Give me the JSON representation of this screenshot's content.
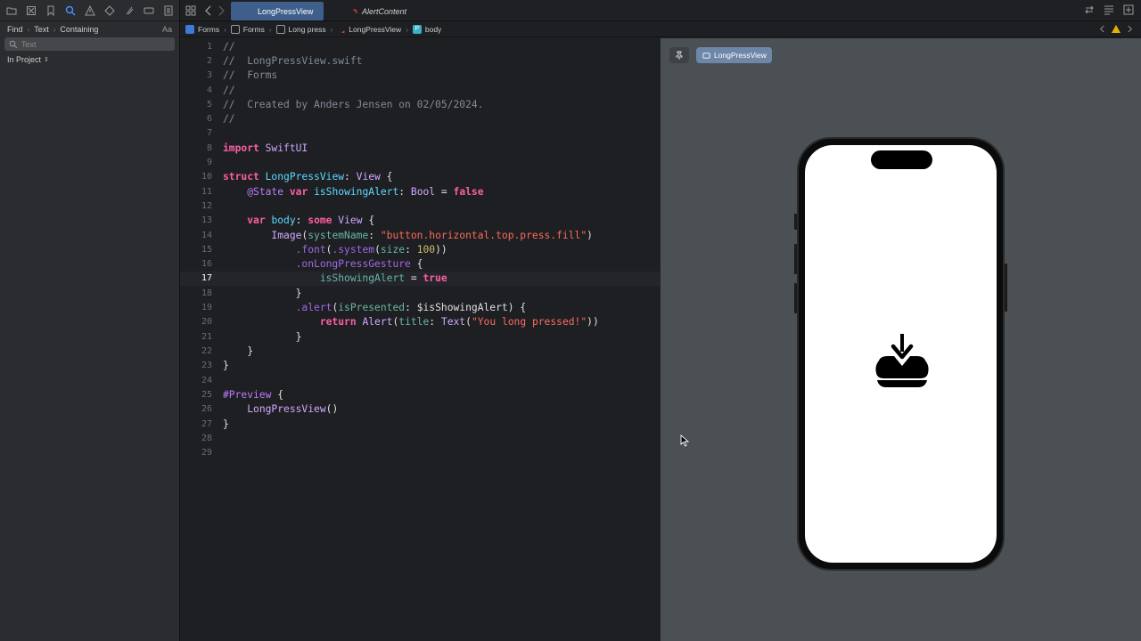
{
  "navigator": {
    "find_label": "Find",
    "text_label": "Text",
    "containing_label": "Containing",
    "case_label": "Aa",
    "search_placeholder": "Text",
    "scope_label": "In Project"
  },
  "tabs": [
    {
      "label": "LongPressView",
      "active": true
    },
    {
      "label": "AlertContent",
      "active": false
    }
  ],
  "jumpbar": {
    "crumbs": [
      "Forms",
      "Forms",
      "Long press",
      "LongPressView",
      "body"
    ]
  },
  "editor": {
    "current_line": 17,
    "line_numbers": [
      "1",
      "2",
      "3",
      "4",
      "5",
      "6",
      "7",
      "8",
      "9",
      "10",
      "11",
      "12",
      "13",
      "14",
      "15",
      "16",
      "17",
      "18",
      "19",
      "20",
      "21",
      "22",
      "23",
      "24",
      "25",
      "26",
      "27",
      "28",
      "29"
    ],
    "lines": [
      "//",
      "//  LongPressView.swift",
      "//  Forms",
      "//",
      "//  Created by Anders Jensen on 02/05/2024.",
      "//",
      "",
      "import SwiftUI",
      "",
      "struct LongPressView: View {",
      "    @State var isShowingAlert: Bool = false",
      "",
      "    var body: some View {",
      "        Image(systemName: \"button.horizontal.top.press.fill\")",
      "            .font(.system(size: 100))",
      "            .onLongPressGesture {",
      "                isShowingAlert = true",
      "            }",
      "            .alert(isPresented: $isShowingAlert) {",
      "                return Alert(title: Text(\"You long pressed!\"))",
      "            }",
      "    }",
      "}",
      "",
      "#Preview {",
      "    LongPressView()",
      "}",
      "",
      ""
    ]
  },
  "preview": {
    "chip_label": "LongPressView",
    "device_icon": "button-horizontal-top-press-fill-icon"
  },
  "colors": {
    "keyword": "#fc5fa3",
    "string": "#fc6a5d",
    "comment": "#7f8c98",
    "type": "#d0a8ff",
    "declaration": "#5dd8ff",
    "active_tab": "#3e5f8c",
    "warning": "#e5b100"
  }
}
